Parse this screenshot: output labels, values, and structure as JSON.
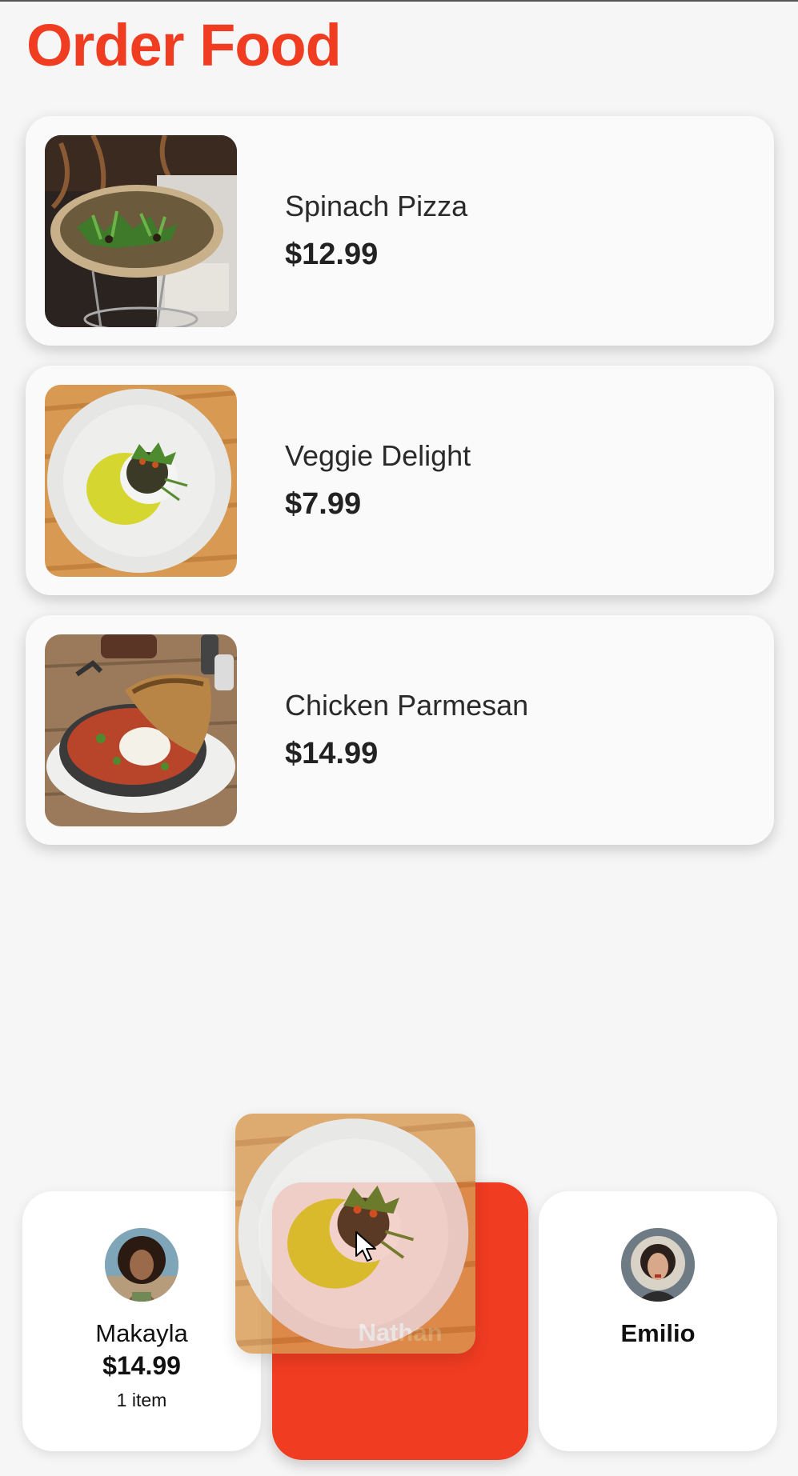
{
  "app": {
    "title": "Order Food"
  },
  "menu": [
    {
      "name": "Spinach Pizza",
      "price": "$12.99",
      "image_icon": "spinach-pizza-photo"
    },
    {
      "name": "Veggie Delight",
      "price": "$7.99",
      "image_icon": "veggie-delight-photo"
    },
    {
      "name": "Chicken Parmesan",
      "price": "$14.99",
      "image_icon": "chicken-parmesan-photo"
    }
  ],
  "customers": [
    {
      "name": "Makayla",
      "total": "$14.99",
      "items": "1 item"
    },
    {
      "name": "Nathan",
      "total": "",
      "items": ""
    },
    {
      "name": "Emilio",
      "total": "",
      "items": ""
    }
  ],
  "drag": {
    "item": "Veggie Delight",
    "cursor_icon": "arrow-cursor-icon"
  },
  "colors": {
    "accent": "#f03c21",
    "card": "#fafafa",
    "background": "#f6f6f6"
  }
}
